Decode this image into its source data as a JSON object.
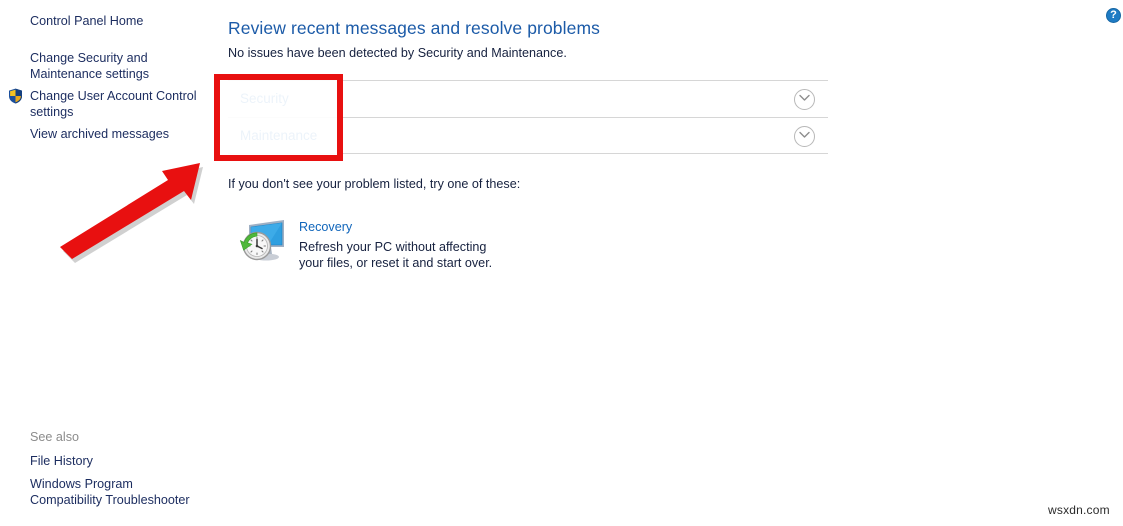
{
  "window": {
    "help_label": "?"
  },
  "sidebar": {
    "items": [
      {
        "label": "Control Panel Home",
        "icon": null
      },
      {
        "label": "Change Security and\nMaintenance settings",
        "icon": null
      },
      {
        "label": "Change User Account Control\nsettings",
        "icon": "uac-shield-icon"
      },
      {
        "label": "View archived messages",
        "icon": null
      }
    ],
    "see_also_heading": "See also",
    "see_also_items": [
      {
        "label": "File History"
      },
      {
        "label": "Windows Program\nCompatibility Troubleshooter"
      }
    ]
  },
  "main": {
    "title": "Review recent messages and resolve problems",
    "subtitle": "No issues have been detected by Security and Maintenance.",
    "rows": [
      {
        "label": "Security",
        "expand_icon": "chevron-down-icon",
        "expanded": false
      },
      {
        "label": "Maintenance",
        "expand_icon": "chevron-down-icon",
        "expanded": false
      }
    ],
    "hint": "If you don't see your problem listed, try one of these:",
    "recovery": {
      "icon": "recovery-monitor-clock-icon",
      "link": "Recovery",
      "description": "Refresh your PC without affecting your files, or reset it and start over."
    }
  },
  "annotations": {
    "highlight_box_color": "#e81010",
    "arrow_color": "#e81010"
  },
  "watermark": {
    "text": "wsxdn.com"
  },
  "colors": {
    "title_blue": "#1c5ba8",
    "link_blue": "#1166bb",
    "sidebar_navy": "#1b2c5f",
    "body_text": "#16213f",
    "divider": "#d6d6d6",
    "accent_red": "#e81010"
  }
}
